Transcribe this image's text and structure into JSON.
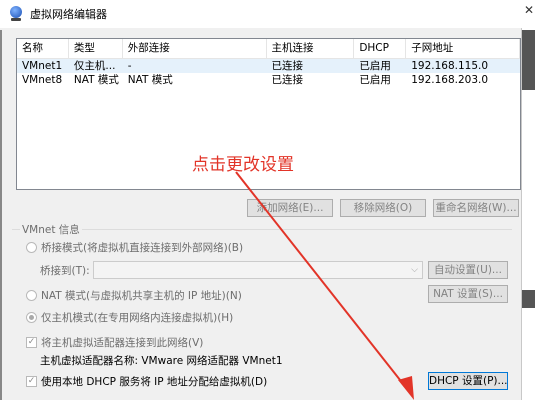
{
  "window": {
    "title": "虚拟网络编辑器"
  },
  "network_table": {
    "columns": [
      "名称",
      "类型",
      "外部连接",
      "主机连接",
      "DHCP",
      "子网地址"
    ],
    "rows": [
      [
        "VMnet1",
        "仅主机...",
        "-",
        "已连接",
        "已启用",
        "192.168.115.0"
      ],
      [
        "VMnet8",
        "NAT 模式",
        "NAT 模式",
        "已连接",
        "已启用",
        "192.168.203.0"
      ]
    ]
  },
  "buttons": {
    "add_network": "添加网络(E)...",
    "remove_network": "移除网络(O)",
    "rename_network": "重命名网络(W)...",
    "auto_settings": "自动设置(U)...",
    "nat_settings": "NAT 设置(S)...",
    "dhcp_settings": "DHCP 设置(P)..."
  },
  "vmnet_info": {
    "group_title": "VMnet 信息",
    "bridged_mode": "桥接模式(将虚拟机直接连接到外部网络)(B)",
    "bridge_to_label": "桥接到(T):",
    "nat_mode": "NAT 模式(与虚拟机共享主机的 IP 地址)(N)",
    "host_only_mode": "仅主机模式(在专用网络内连接虚拟机)(H)",
    "connect_adapter": "将主机虚拟适配器连接到此网络(V)",
    "adapter_name": "主机虚拟适配器名称: VMware 网络适配器 VMnet1",
    "use_dhcp": "使用本地 DHCP 服务将 IP 地址分配给虚拟机(D)"
  },
  "annotation": {
    "text": "点击更改设置",
    "color": "#e23428"
  }
}
